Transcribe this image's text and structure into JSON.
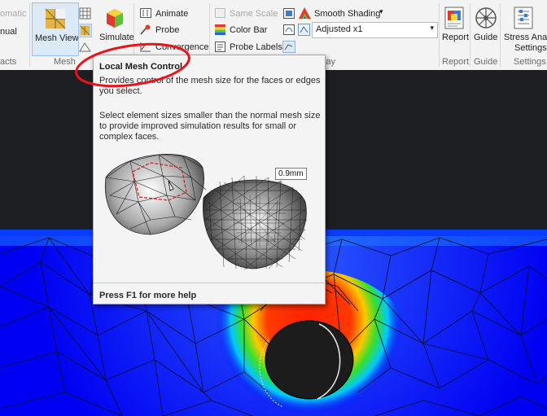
{
  "ribbon": {
    "automatic_label": "omatic",
    "manual_label": "nual",
    "contacts_group": "acts",
    "mesh_view_label": "Mesh View",
    "simulate_label": "Simulate",
    "mesh_group": "Mesh",
    "animate_label": "Animate",
    "probe_label": "Probe",
    "convergence_label": "Convergence",
    "same_scale_label": "Same Scale",
    "color_bar_label": "Color Bar",
    "probe_labels_label": "Probe Labels",
    "smooth_shading_label": "Smooth Shading",
    "adjusted_value": "Adjusted x1",
    "display_group": "lay",
    "report_label": "Report",
    "report_group": "Report",
    "guide_label": "Guide",
    "guide_group": "Guide",
    "stress_line1": "Stress Analy",
    "stress_line2": "Settings",
    "settings_group": "Settings"
  },
  "tooltip": {
    "title": "Local Mesh Control",
    "description": "Provides control of the mesh size for the faces or edges you select.",
    "detail": "Select element sizes smaller than the normal mesh size to provide improved simulation results for small or complex faces.",
    "dimension": "0.9mm",
    "help": "Press F1 for more help"
  },
  "colors": {
    "annotation_circle": "#e8141c",
    "viewport_blue": "#0000f2",
    "ribbon_bg": "#f3f3f3"
  }
}
